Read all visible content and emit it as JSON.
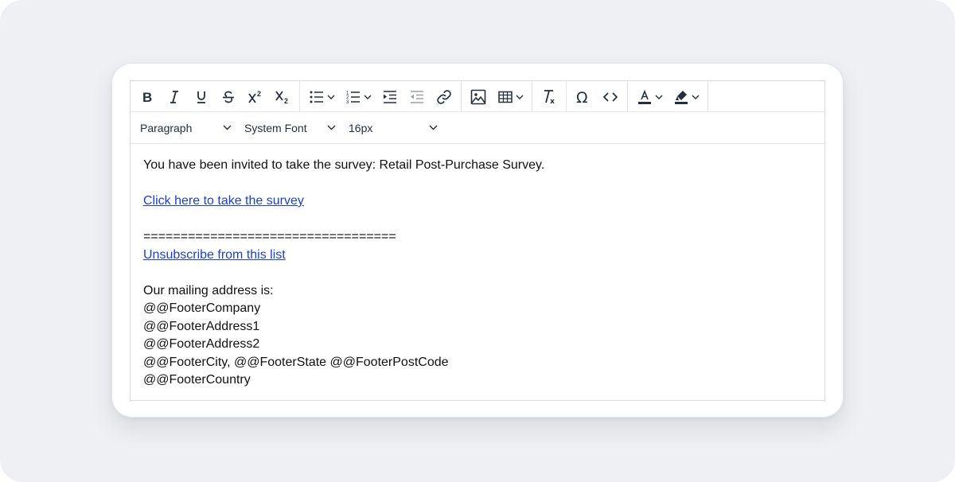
{
  "toolbar": {
    "bold": "bold-icon",
    "italic": "italic-icon",
    "underline": "underline-icon",
    "strikethrough": "strikethrough-icon",
    "superscript": "superscript-icon",
    "subscript": "subscript-icon",
    "bullet_list": "bullet-list-icon",
    "numbered_list": "numbered-list-icon",
    "indent": "indent-icon",
    "outdent": "outdent-icon",
    "link": "link-icon",
    "image": "image-icon",
    "table": "table-icon",
    "clear_format": "clear-formatting-icon",
    "special_char": "omega-icon",
    "source_code": "code-icon",
    "text_color": "text-color-icon",
    "highlight_color": "highlight-icon"
  },
  "format": {
    "block_format": "Paragraph",
    "font_family": "System Font",
    "font_size": "16px"
  },
  "content": {
    "intro": "You have been invited to take the survey: Retail Post-Purchase Survey.",
    "survey_link": "Click here to take the survey",
    "separator": "==================================",
    "unsubscribe_link": "Unsubscribe from this list",
    "mailing_label": "Our mailing address is:",
    "footer_company": "@@FooterCompany",
    "footer_address1": "@@FooterAddress1",
    "footer_address2": "@@FooterAddress2",
    "footer_city_line": "@@FooterCity, @@FooterState @@FooterPostCode",
    "footer_country": "@@FooterCountry"
  },
  "colors": {
    "link": "#1a3fd3",
    "icon": "#222f3e",
    "backdrop": "#eef0f3"
  }
}
